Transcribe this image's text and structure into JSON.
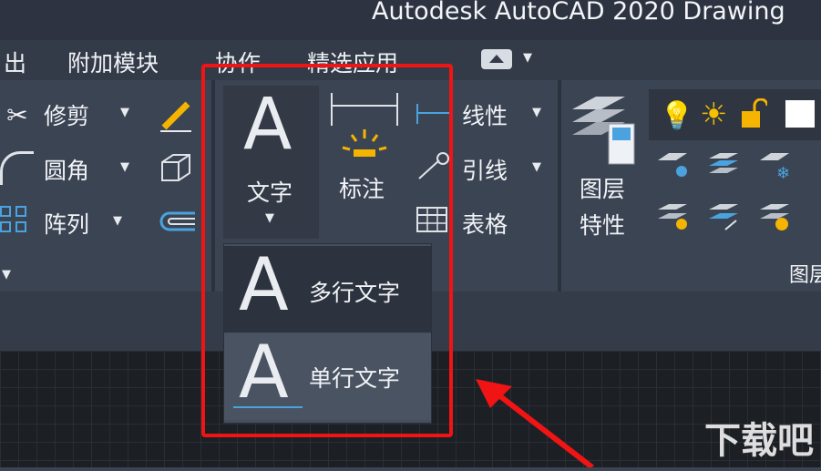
{
  "app": {
    "title": "Autodesk AutoCAD 2020    Drawing"
  },
  "menubar": {
    "items": [
      "出",
      "附加模块",
      "协作",
      "精选应用"
    ]
  },
  "ribbon": {
    "modify": {
      "trim": "修剪",
      "fillet": "圆角",
      "array": "阵列"
    },
    "annotation": {
      "text_label": "文字",
      "dim_label": "标注",
      "linear": "线性",
      "leader": "引线",
      "table": "表格"
    },
    "layers": {
      "layer_props_line1": "图层",
      "layer_props_line2": "特性",
      "panel_title": "图层"
    }
  },
  "text_dropdown": {
    "multiline": "多行文字",
    "single_line": "单行文字"
  },
  "watermark": "下载吧",
  "colors": {
    "highlight_box": "#f01414",
    "accent_yellow": "#f5b400",
    "accent_blue": "#4aa3df"
  }
}
